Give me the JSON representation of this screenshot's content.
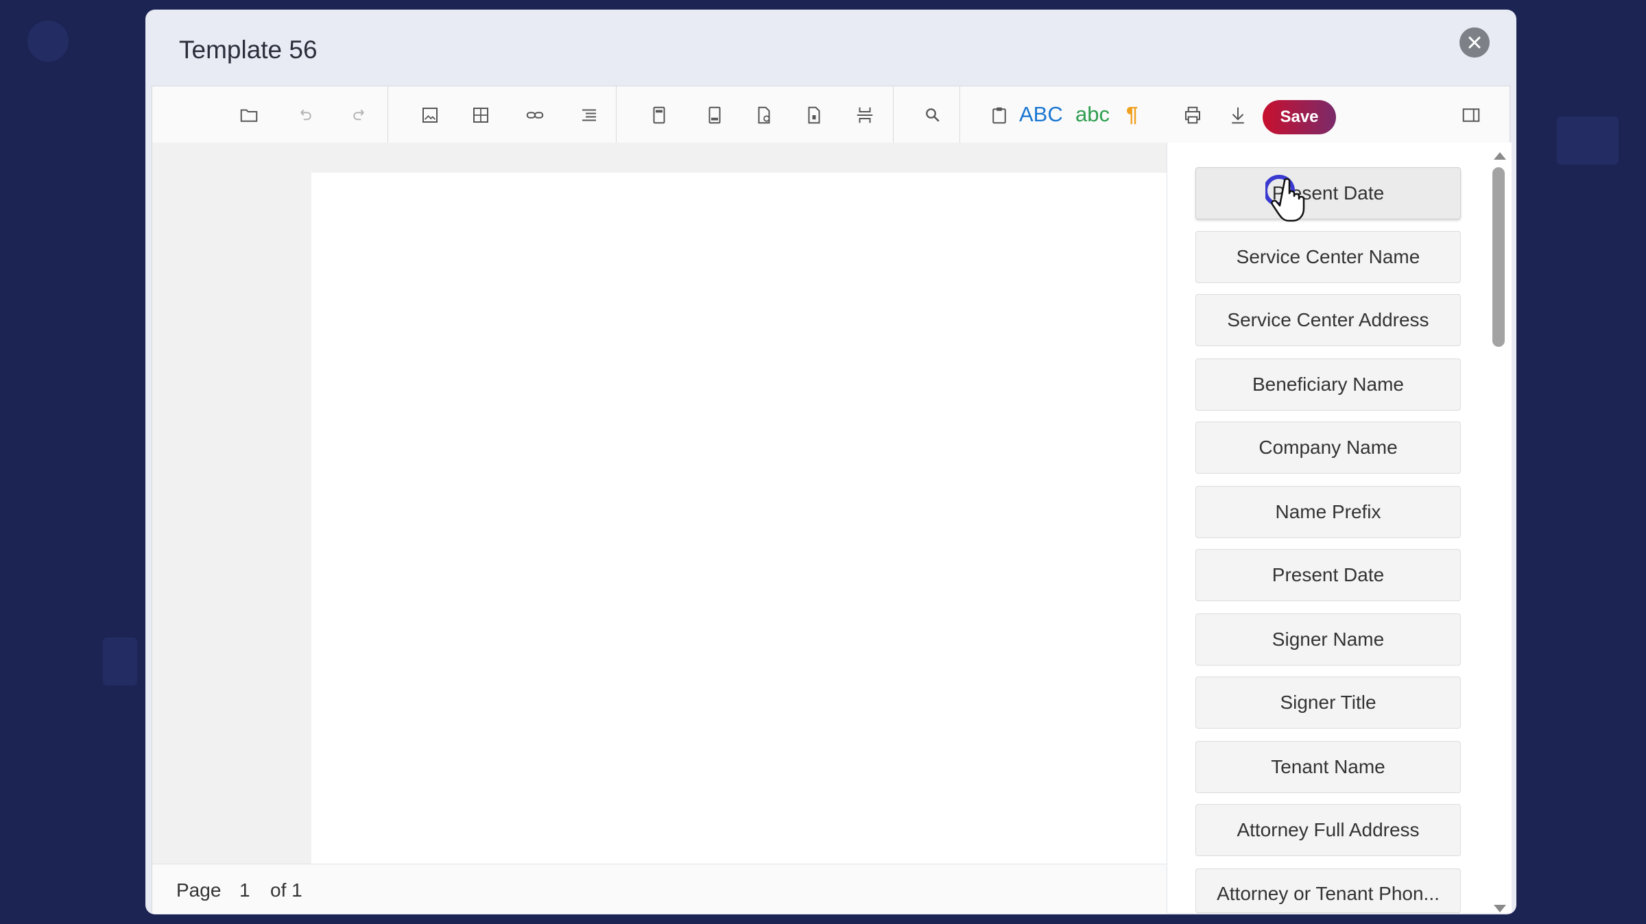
{
  "modal": {
    "title": "Template 56"
  },
  "toolbar": {
    "save_label": "Save",
    "spellcheck_upper": "ABC",
    "spellcheck_lower": "abc",
    "pilcrow": "¶"
  },
  "status": {
    "page_label": "Page",
    "page_number": "1",
    "of_label": "of 1"
  },
  "fields": [
    "Present Date",
    "Service Center Name",
    "Service Center Address",
    "Beneficiary Name",
    "Company Name",
    "Name Prefix",
    "Present Date",
    "Signer Name",
    "Signer Title",
    "Tenant Name",
    "Attorney Full Address",
    "Attorney or Tenant Phon..."
  ],
  "colors": {
    "save_start": "#c8102e",
    "save_end": "#7a2a6a",
    "abc_upper": "#1976d2",
    "abc_lower": "#2e9e4f",
    "pilcrow": "#f0a020"
  }
}
